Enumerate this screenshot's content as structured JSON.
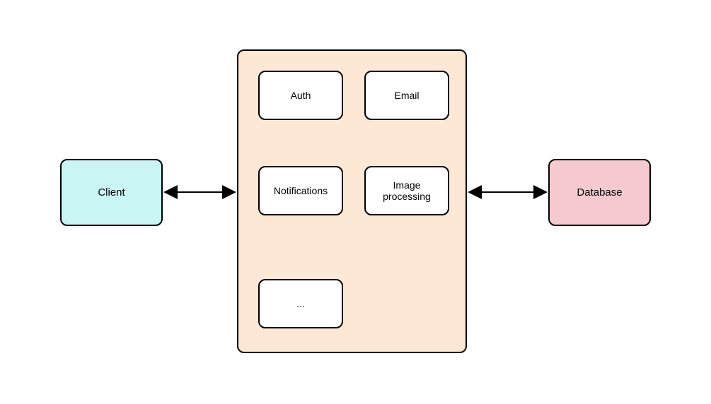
{
  "nodes": {
    "client": "Client",
    "database": "Database",
    "services": {
      "auth": "Auth",
      "email": "Email",
      "notifications": "Notifications",
      "image_processing": "Image\nprocessing",
      "ellipsis": "..."
    }
  },
  "colors": {
    "client_bg": "#c9f5f5",
    "server_bg": "#fce8d5",
    "database_bg": "#f5c9cf",
    "inner_bg": "#ffffff",
    "stroke": "#000000"
  }
}
